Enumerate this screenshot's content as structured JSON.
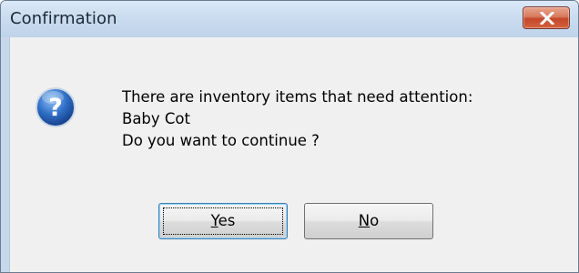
{
  "window": {
    "title": "Confirmation",
    "close_icon": "close-icon"
  },
  "dialog": {
    "icon": "question-icon",
    "message_lines": [
      "There are inventory items that need attention:",
      "Baby Cot",
      "Do you want to continue ?"
    ]
  },
  "buttons": {
    "yes": {
      "mnemonic": "Y",
      "rest": "es"
    },
    "no": {
      "mnemonic": "N",
      "rest": "o"
    }
  },
  "colors": {
    "titlebar": "#c9dbef",
    "client_background": "#f0f0f0",
    "close_button": "#c4472a",
    "question_icon": "#2f6fc6"
  }
}
